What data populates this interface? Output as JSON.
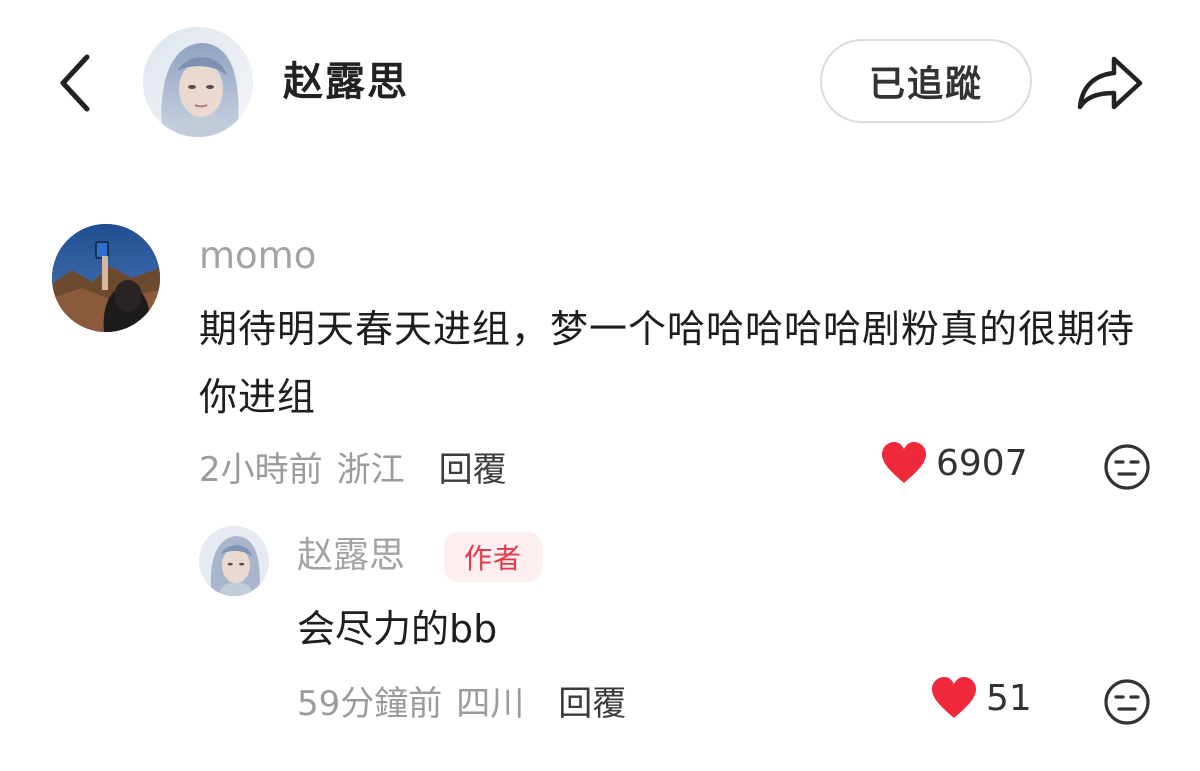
{
  "header": {
    "title": "赵露思",
    "follow_label": "已追蹤",
    "back_icon": "chevron-left-icon",
    "share_icon": "share-arrow-icon"
  },
  "comment": {
    "username": "momo",
    "text": "期待明天春天进组，梦一个哈哈哈哈哈剧粉真的很期待你进组",
    "time": "2小時前",
    "location": "浙江",
    "reply_label": "回覆",
    "likes": "6907"
  },
  "reply": {
    "username": "赵露思",
    "badge": "作者",
    "text": "会尽力的bb",
    "time": "59分鐘前",
    "location": "四川",
    "reply_label": "回覆",
    "likes": "51"
  },
  "colors": {
    "like": "#f0283c",
    "badge_text": "#e5384a",
    "badge_bg": "#fdeef0",
    "muted_text": "#9b9b9b"
  }
}
